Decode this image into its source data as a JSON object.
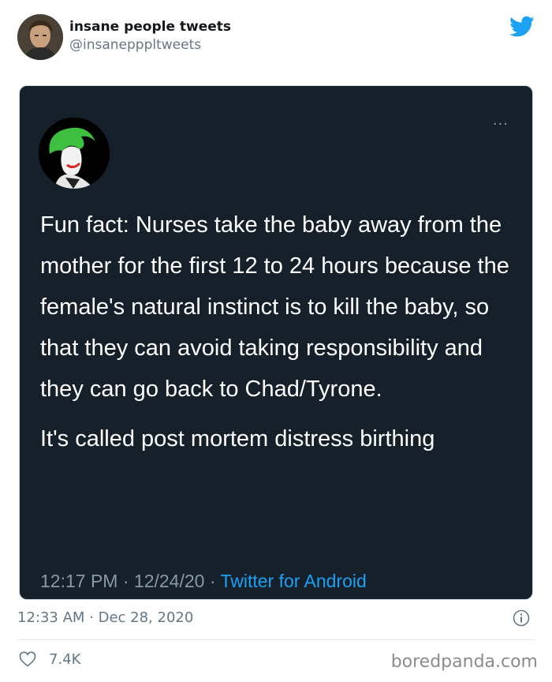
{
  "header": {
    "display_name": "insane people tweets",
    "handle": "@insanepppltweets"
  },
  "embedded_tweet": {
    "paragraphs": [
      "Fun fact: Nurses take the baby away from the mother for the first 12 to 24 hours because the female's natural instinct is to kill the baby, so that they can avoid taking responsibility and they can go back to Chad/Tyrone.",
      "It's called post mortem distress birthing"
    ],
    "time": "12:17 PM",
    "date": "12/24/20",
    "source": "Twitter for Android",
    "separator": " · ",
    "more_label": "···"
  },
  "footer": {
    "timestamp": "12:33 AM · Dec 28, 2020",
    "like_count": "7.4K"
  },
  "watermark": "boredpanda.com",
  "icons": {
    "brand": "twitter-bird-icon",
    "info": "info-icon",
    "like": "heart-icon"
  },
  "colors": {
    "twitter_blue": "#1da1f2",
    "embed_background": "#15202b",
    "muted_text": "#657786"
  }
}
